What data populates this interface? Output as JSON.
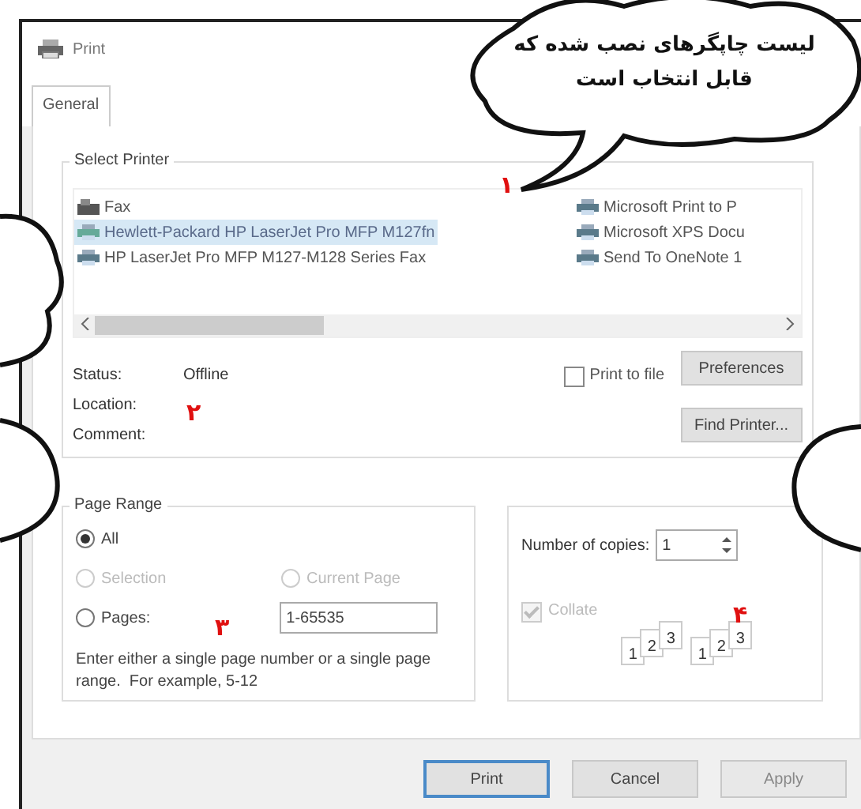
{
  "window": {
    "title": "Print"
  },
  "tabs": [
    {
      "label": "General",
      "selected": true
    }
  ],
  "select_printer": {
    "title": "Select Printer",
    "printers": [
      {
        "name": "Fax",
        "kind": "fax",
        "selected": false
      },
      {
        "name": "Hewlett-Packard HP LaserJet Pro MFP M127fn",
        "kind": "printer",
        "selected": true
      },
      {
        "name": "HP LaserJet Pro MFP M127-M128 Series Fax",
        "kind": "printer",
        "selected": false
      },
      {
        "name": "Microsoft Print to P",
        "kind": "printer",
        "selected": false
      },
      {
        "name": "Microsoft XPS Docu",
        "kind": "printer",
        "selected": false
      },
      {
        "name": "Send To OneNote 1",
        "kind": "printer",
        "selected": false
      }
    ],
    "status_label": "Status:",
    "status": "Offline",
    "location_label": "Location:",
    "comment_label": "Comment:",
    "print_to_file": {
      "label": "Print to file",
      "checked": false
    },
    "preferences_button": "Preferences",
    "find_button": "Find Printer..."
  },
  "page_range": {
    "title": "Page Range",
    "options": [
      {
        "label": "All",
        "selected": true,
        "disabled": false
      },
      {
        "label": "Selection",
        "selected": false,
        "disabled": true
      },
      {
        "label": "Current Page",
        "selected": false,
        "disabled": true
      },
      {
        "label": "Pages:",
        "selected": false,
        "disabled": false
      }
    ],
    "pages_value": "1-65535",
    "hint": "Enter either a single page number or a single page range.  For example, 5-12"
  },
  "copies": {
    "label": "Number of copies:",
    "value": "1",
    "collate": {
      "label": "Collate",
      "checked": true,
      "disabled": true
    },
    "collate_stacks": [
      [
        "1",
        "2",
        "3"
      ],
      [
        "1",
        "2",
        "3"
      ]
    ]
  },
  "buttons": [
    {
      "label": "Print",
      "disabled": false,
      "default": true
    },
    {
      "label": "Cancel",
      "disabled": false,
      "default": false
    },
    {
      "label": "Apply",
      "disabled": true,
      "default": false
    }
  ],
  "callout": {
    "text": "لیست چاپگرهای نصب شده که قابل انتخاب است"
  },
  "markers": [
    "۱",
    "۲",
    "۳",
    "۴"
  ]
}
